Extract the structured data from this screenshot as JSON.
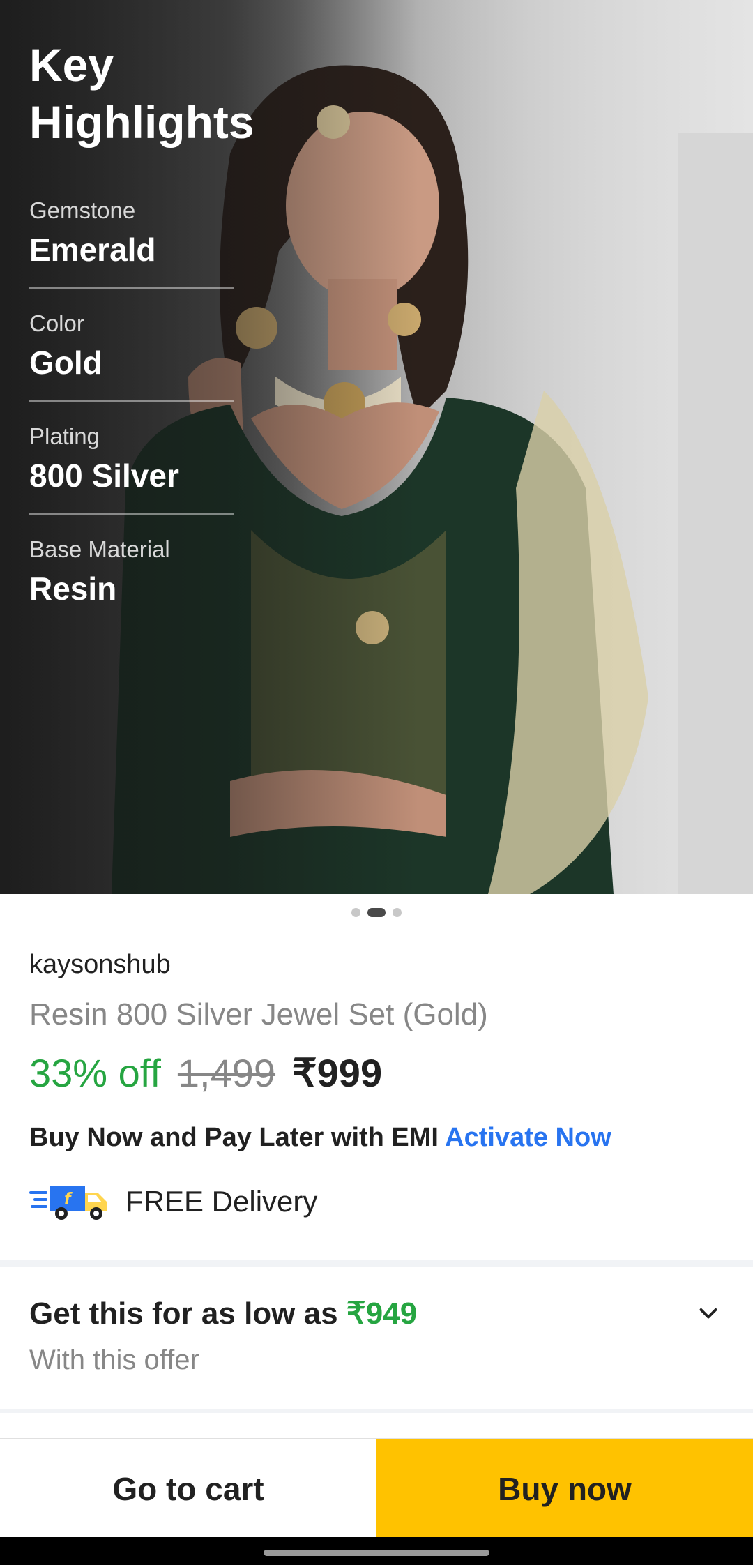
{
  "key_highlights": {
    "title": "Key Highlights",
    "items": [
      {
        "label": "Gemstone",
        "value": "Emerald"
      },
      {
        "label": "Color",
        "value": "Gold"
      },
      {
        "label": "Plating",
        "value": "800 Silver"
      },
      {
        "label": "Base Material",
        "value": "Resin"
      }
    ]
  },
  "carousel": {
    "dots": 3,
    "active_index": 1
  },
  "product": {
    "seller": "kaysonshub",
    "title": "Resin 800 Silver Jewel Set (Gold)",
    "discount": "33% off",
    "mrp": "1,499",
    "price": "₹999"
  },
  "emi": {
    "text": "Buy Now and Pay Later with EMI",
    "link": "Activate Now"
  },
  "delivery": {
    "text": "FREE Delivery",
    "icon": "delivery-truck-icon"
  },
  "offer": {
    "text": "Get this for as low as",
    "price": "₹949",
    "subtext": "With this offer"
  },
  "actions": {
    "cart_label": "Go to cart",
    "buy_label": "Buy now"
  },
  "colors": {
    "accent_green": "#26a541",
    "link_blue": "#2874f0",
    "buy_yellow": "#ffc200",
    "muted": "#878787"
  }
}
